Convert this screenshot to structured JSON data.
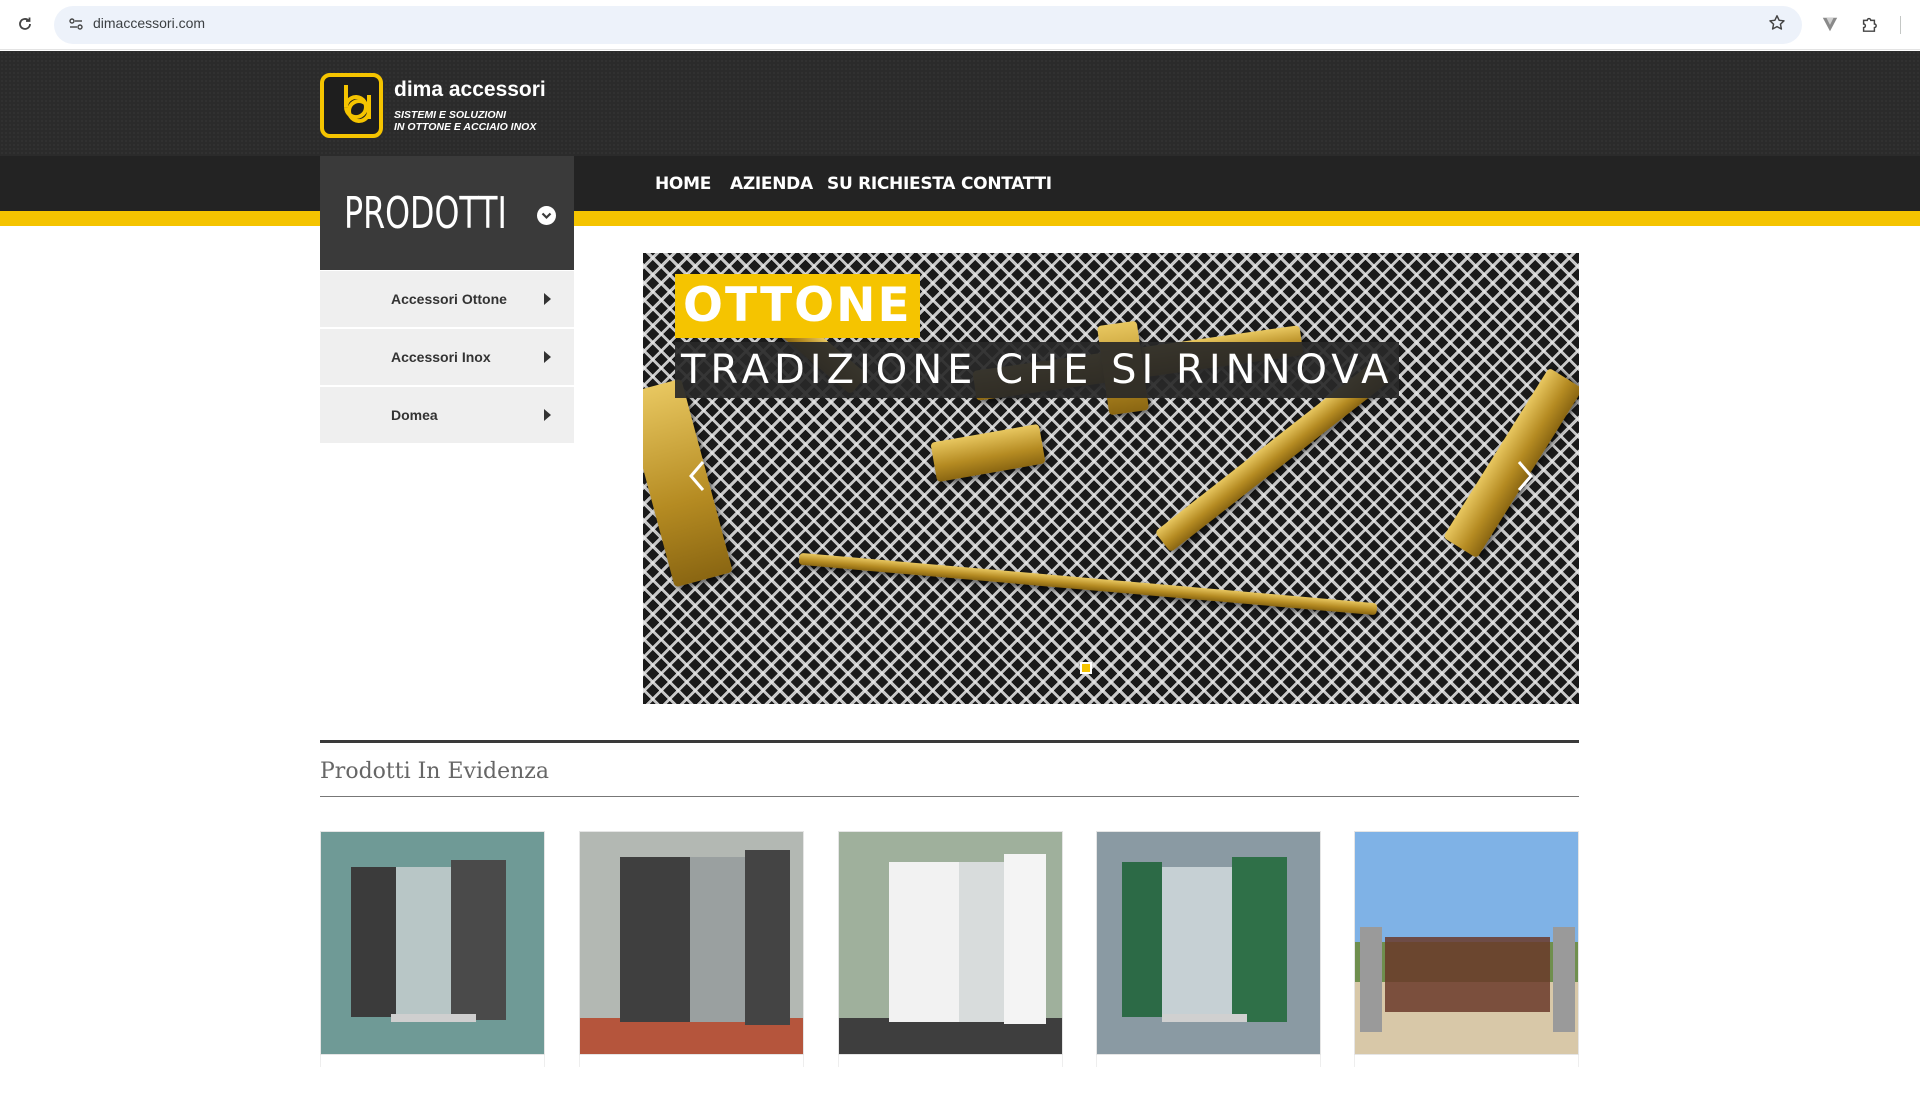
{
  "browser": {
    "url": "dimaccessori.com"
  },
  "logo": {
    "brand": "dima accessori",
    "tagline_line1": "SISTEMI E SOLUZIONI",
    "tagline_line2": "IN OTTONE E ACCIAIO INOX"
  },
  "nav": {
    "items": [
      "HOME",
      "AZIENDA",
      "SU RICHIESTA",
      "CONTATTI"
    ]
  },
  "products_menu": {
    "title": "PRODOTTI",
    "items": [
      "Accessori Ottone",
      "Accessori Inox",
      "Domea"
    ]
  },
  "slider": {
    "headline": "OTTONE",
    "subheadline": "TRADIZIONE CHE SI RINNOVA",
    "active_slide": 1
  },
  "featured": {
    "title": "Prodotti In Evidenza",
    "cards": [
      {
        "icon": "shutter-dark-wood-image"
      },
      {
        "icon": "shutter-dark-double-image"
      },
      {
        "icon": "shutter-white-louvered-image"
      },
      {
        "icon": "shutter-green-louvered-image"
      },
      {
        "icon": "wooden-gate-image"
      }
    ]
  },
  "colors": {
    "accent": "#f5c400",
    "header_bg": "#2b2b2b",
    "nav_bg": "#232323"
  }
}
